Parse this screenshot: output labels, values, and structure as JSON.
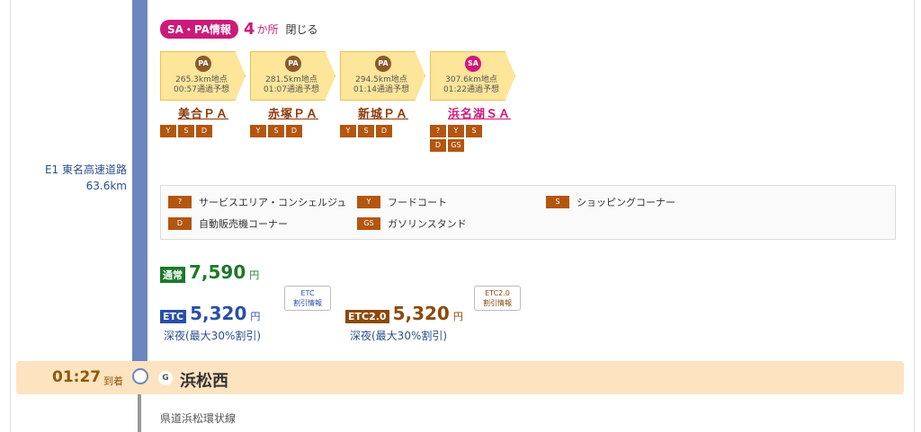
{
  "road": {
    "name": "E1 東名高速道路",
    "distance": "63.6km"
  },
  "sapa": {
    "badge": "SA・PA情報",
    "count": "4",
    "unit": "か所",
    "close": "閉じる",
    "stops": [
      {
        "type": "PA",
        "km": "265.3km地点",
        "eta": "00:57通過予想",
        "name": "美合ＰＡ",
        "facilities": [
          "フードコート",
          "ショッピングコーナー",
          "自動販売機コーナー"
        ]
      },
      {
        "type": "PA",
        "km": "281.5km地点",
        "eta": "01:07通過予想",
        "name": "赤塚ＰＡ",
        "facilities": [
          "フードコート",
          "ショッピングコーナー",
          "自動販売機コーナー"
        ]
      },
      {
        "type": "PA",
        "km": "294.5km地点",
        "eta": "01:14通過予想",
        "name": "新城ＰＡ",
        "facilities": [
          "フードコート",
          "ショッピングコーナー",
          "自動販売機コーナー"
        ]
      },
      {
        "type": "SA",
        "km": "307.6km地点",
        "eta": "01:22通過予想",
        "name": "浜名湖ＳＡ",
        "facilities": [
          "サービスエリア・コンシェルジュ",
          "フードコート",
          "ショッピングコーナー",
          "自動販売機コーナー",
          "ガソリンスタンド"
        ]
      }
    ]
  },
  "legend": [
    {
      "icon": "?",
      "label": "サービスエリア・コンシェルジュ"
    },
    {
      "icon": "Y",
      "label": "フードコート"
    },
    {
      "icon": "S",
      "label": "ショッピングコーナー"
    },
    {
      "icon": "D",
      "label": "自動販売機コーナー"
    },
    {
      "icon": "GS",
      "label": "ガソリンスタンド"
    }
  ],
  "price": {
    "normal_tag": "通常",
    "normal_value": "7,590",
    "yen": "円",
    "etc_tag": "ETC",
    "etc_value": "5,320",
    "etc_bubble_1": "ETC",
    "etc_bubble_2": "割引情報",
    "etc_night": "深夜(最大30%割引)",
    "etc2_tag": "ETC2.0",
    "etc2_value": "5,320",
    "etc2_bubble_1": "ETC2.0",
    "etc2_bubble_2": "割引情報",
    "etc2_night": "深夜(最大30%割引)"
  },
  "arrival": {
    "time": "01:27",
    "label": "到着",
    "g_badge": "G",
    "station": "浜松西"
  },
  "next_road": "県道浜松環状線"
}
